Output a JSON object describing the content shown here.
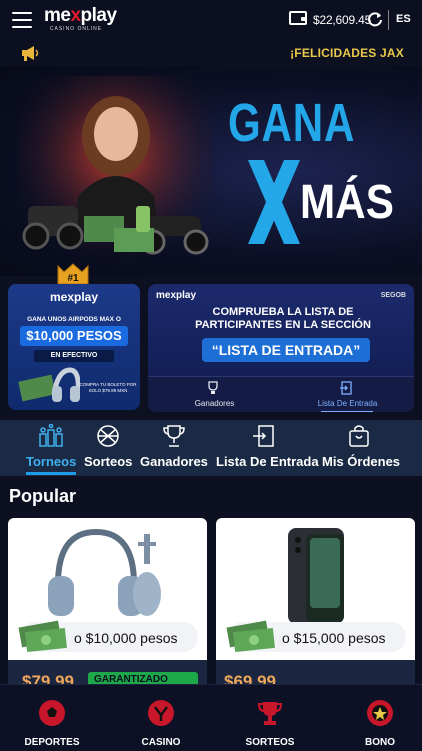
{
  "header": {
    "logo_wordmark_left": "me",
    "logo_wordmark_x": "x",
    "logo_wordmark_right": "play",
    "logo_subtitle": "CASINO ONLINE",
    "balance": "$22,609.45",
    "language": "ES",
    "icons": [
      "menu-icon",
      "wallet-icon",
      "refresh-icon"
    ]
  },
  "announcement": {
    "icon": "megaphone-icon",
    "text": "¡FELICIDADES JAX"
  },
  "hero": {
    "line1": "GANA",
    "line2": "MÁS"
  },
  "promos": {
    "left": {
      "rank_badge": "#1",
      "logo": "mexplay",
      "headline": "GANA UNOS AIRPODS MAX O",
      "amount": "$10,000 PESOS",
      "cash_label": "EN EFECTIVO",
      "note": "COMPRA TU BOLETO POR SOLO $79.99 MXN"
    },
    "right": {
      "logo": "mexplay",
      "regulator": "SEGOB",
      "title_line1": "COMPRUEBA LA LISTA DE",
      "title_line2": "PARTICIPANTES EN LA SECCIÓN",
      "highlight": "“LISTA DE ENTRADA”",
      "tabs": [
        {
          "label": "Ganadores",
          "icon": "trophy-icon"
        },
        {
          "label": "Lista De Entrada",
          "icon": "list-exit-icon"
        }
      ]
    }
  },
  "nav": {
    "items": [
      {
        "label": "Torneos",
        "icon": "tournament-icon"
      },
      {
        "label": "Sorteos",
        "icon": "raffle-icon"
      },
      {
        "label": "Ganadores",
        "icon": "trophy-icon"
      },
      {
        "label": "Lista De Entrada",
        "icon": "entry-list-icon"
      },
      {
        "label": "Mis Órdenes",
        "icon": "bag-icon"
      }
    ],
    "active": "Torneos"
  },
  "section": {
    "title": "Popular"
  },
  "products": [
    {
      "prize_text": "o $10,000 pesos",
      "price": "$79.99",
      "badge": "GARANTIZADO",
      "image": "headphones"
    },
    {
      "prize_text": "o $15,000 pesos",
      "price": "$69.99",
      "image": "foldable-phone"
    }
  ],
  "bottom_nav": {
    "items": [
      {
        "label": "DEPORTES",
        "icon": "soccer-ball-icon"
      },
      {
        "label": "CASINO",
        "icon": "slot-icon"
      },
      {
        "label": "SORTEOS",
        "icon": "trophy-icon"
      },
      {
        "label": "BONO",
        "icon": "bonus-icon"
      }
    ]
  },
  "colors": {
    "background": "#0c1021",
    "accent_blue": "#1d9de8",
    "brand_red": "#e11d2e",
    "ticker_gold": "#e9c94a",
    "price_orange": "#f0a75a",
    "badge_green": "#1ea84a"
  }
}
